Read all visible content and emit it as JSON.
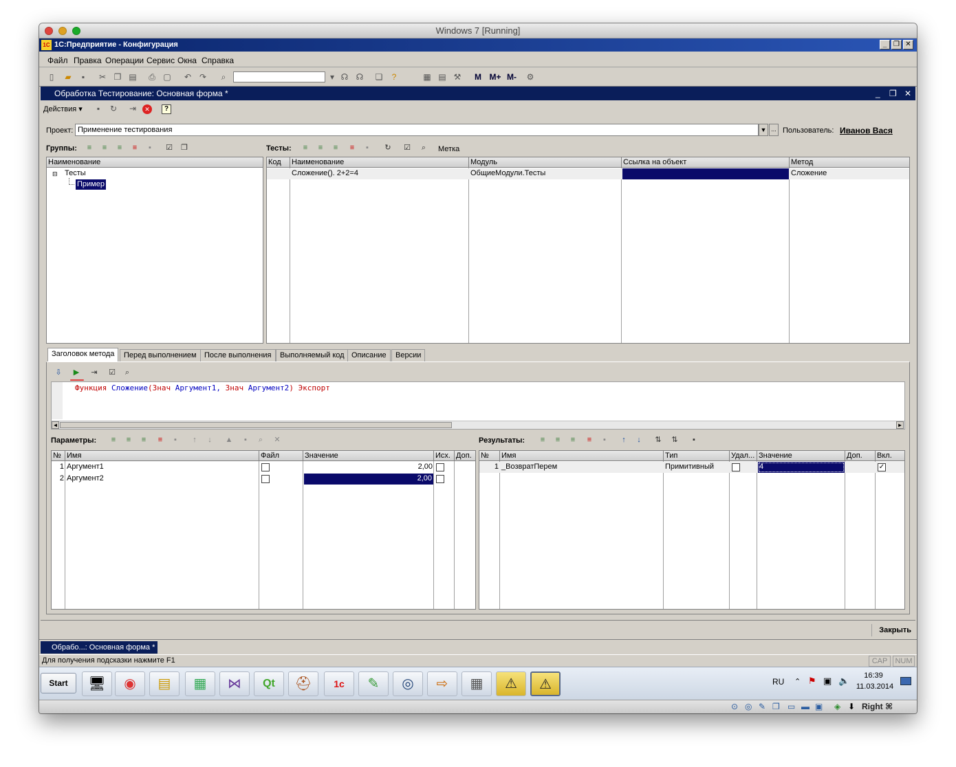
{
  "host": {
    "title": "Windows 7 [Running]"
  },
  "app": {
    "title": "1С:Предприятие - Конфигурация"
  },
  "menu": [
    "Файл",
    "Правка",
    "Операции",
    "Сервис",
    "Окна",
    "Справка"
  ],
  "toolbar": {
    "m1": "M",
    "m2": "M+",
    "m3": "M-"
  },
  "form": {
    "title": "Обработка Тестирование: Основная форма *",
    "actions_label": "Действия",
    "project_label": "Проект:",
    "project_value": "Применение тестирования",
    "user_label": "Пользователь:",
    "user_value": "Иванов Вася",
    "groups_label": "Группы:",
    "tests_label": "Тесты:",
    "tag_label": "Метка",
    "close_button": "Закрыть"
  },
  "groups_grid": {
    "header": "Наименование",
    "root": "Тесты",
    "child": "Пример"
  },
  "tests_grid": {
    "columns": [
      "Код",
      "Наименование",
      "Модуль",
      "Ссылка на объект",
      "Метод"
    ],
    "rows": [
      [
        "",
        "Сложение(). 2+2=4",
        "ОбщиеМодули.Тесты",
        "",
        "Сложение"
      ]
    ]
  },
  "tabs": [
    "Заголовок метода",
    "Перед выполнением",
    "После выполнения",
    "Выполняемый код",
    "Описание",
    "Версии"
  ],
  "code": {
    "keyword_func": "Функция",
    "name": "Сложение",
    "open": "(",
    "kw1": "Знач",
    "arg1": "Аргумент1,",
    "kw2": "Знач",
    "arg2": "Аргумент2",
    "close": ")",
    "kw_export": "Экспорт"
  },
  "params": {
    "label": "Параметры:",
    "columns": [
      "№",
      "Имя",
      "Файл",
      "Значение",
      "Исх.",
      "Доп."
    ],
    "rows": [
      {
        "n": "1",
        "name": "Аргумент1",
        "value": "2,00"
      },
      {
        "n": "2",
        "name": "Аргумент2",
        "value": "2,00"
      }
    ]
  },
  "results": {
    "label": "Результаты:",
    "columns": [
      "№",
      "Имя",
      "Тип",
      "Удал...",
      "Значение",
      "Доп.",
      "Вкл."
    ],
    "rows": [
      {
        "n": "1",
        "name": "_ВозвратПерем",
        "type": "Примитивный",
        "value": "4"
      }
    ]
  },
  "window_tab": "Обрабо...: Основная форма *",
  "statusbar": {
    "hint": "Для получения подсказки нажмите F1",
    "cap": "CAP",
    "num": "NUM"
  },
  "taskbar": {
    "start": "Start",
    "lang": "RU",
    "time": "16:39",
    "date": "11.03.2014"
  },
  "vbox": {
    "host_key": "Right ⌘"
  }
}
